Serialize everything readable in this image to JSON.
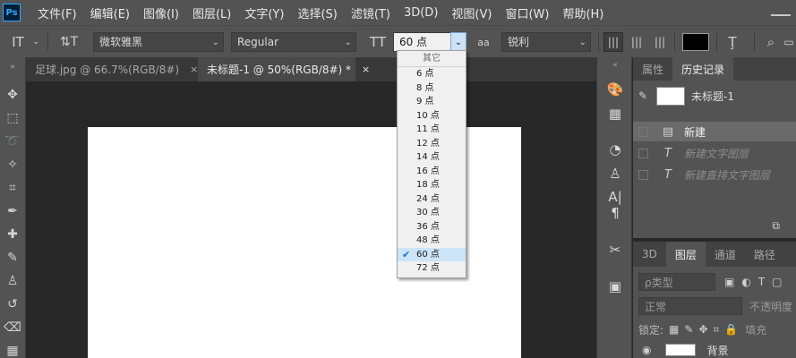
{
  "app": {
    "logo": "Ps"
  },
  "menu": [
    "文件(F)",
    "编辑(E)",
    "图像(I)",
    "图层(L)",
    "文字(Y)",
    "选择(S)",
    "滤镜(T)",
    "3D(D)",
    "视图(V)",
    "窗口(W)",
    "帮助(H)"
  ],
  "options": {
    "font_family": "微软雅黑",
    "font_style": "Regular",
    "font_size": "60 点",
    "antialias_icon_label": "aa",
    "antialias": "锐利"
  },
  "tabs": [
    {
      "label": "足球.jpg @ 66.7%(RGB/8#)",
      "close": "×"
    },
    {
      "label": "未标题-1 @ 50%(RGB/8#) *",
      "close": "×"
    }
  ],
  "size_dropdown": {
    "header": "其它",
    "options": [
      "6 点",
      "8 点",
      "9 点",
      "10 点",
      "11 点",
      "12 点",
      "14 点",
      "16 点",
      "18 点",
      "24 点",
      "30 点",
      "36 点",
      "48 点",
      "60 点",
      "72 点"
    ],
    "selected": "60 点"
  },
  "history_panel": {
    "tabs": [
      "属性",
      "历史记录"
    ],
    "active_tab": "历史记录",
    "snapshot": "未标题-1",
    "items": [
      "新建",
      "新建文字图层",
      "新建直排文字图层"
    ]
  },
  "layers_panel": {
    "tabs": [
      "3D",
      "图层",
      "通道",
      "路径"
    ],
    "active_tab": "图层",
    "filter_kind": "ρ类型",
    "blend_mode": "正常",
    "opacity_label": "不透明度",
    "lock_label": "锁定:",
    "fill_label": "填充",
    "layer_name": "背景"
  },
  "colors": {
    "ui_bg": "#535353",
    "dark_bg": "#282828",
    "canvas": "#ffffff",
    "selection": "#cce4f7",
    "check": "#1a6fd1"
  }
}
